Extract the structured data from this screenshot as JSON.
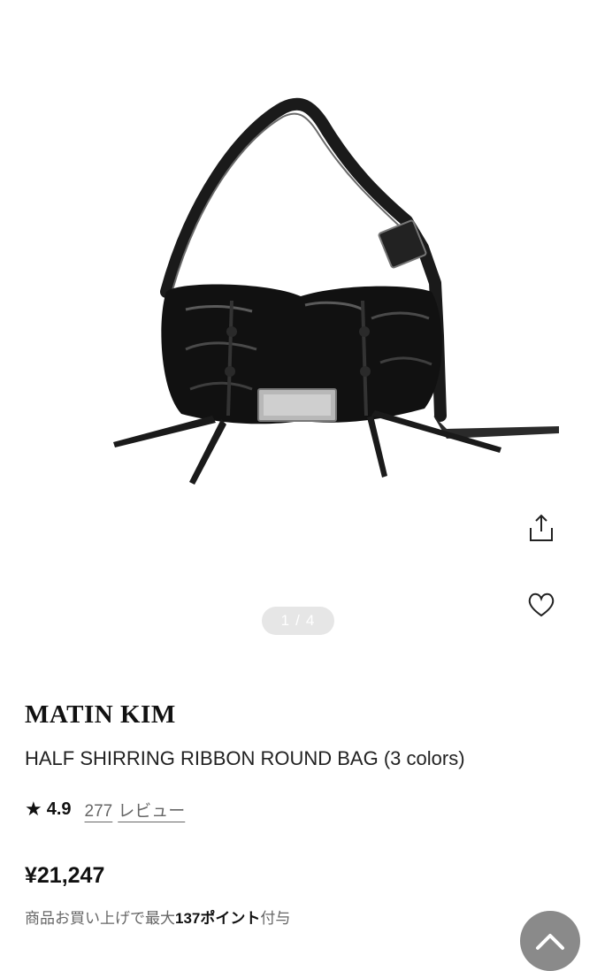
{
  "gallery": {
    "current": "1",
    "separator": "/",
    "total": "4",
    "image_alt_icon": "handbag-photo"
  },
  "actions": {
    "share_icon": "share-icon",
    "favorite_icon": "heart-icon"
  },
  "product": {
    "brand": "MATIN KIM",
    "title": "HALF SHIRRING RIBBON ROUND BAG (3 colors)",
    "rating_icon": "star-icon",
    "rating": "4.9",
    "review_count": "277",
    "review_label": "レビュー",
    "price": "¥21,247",
    "points_prefix": "商品お買い上げで最大",
    "points_value": "137ポイント",
    "points_suffix": "付与"
  },
  "scroll_top": {
    "icon": "chevron-up-icon"
  }
}
